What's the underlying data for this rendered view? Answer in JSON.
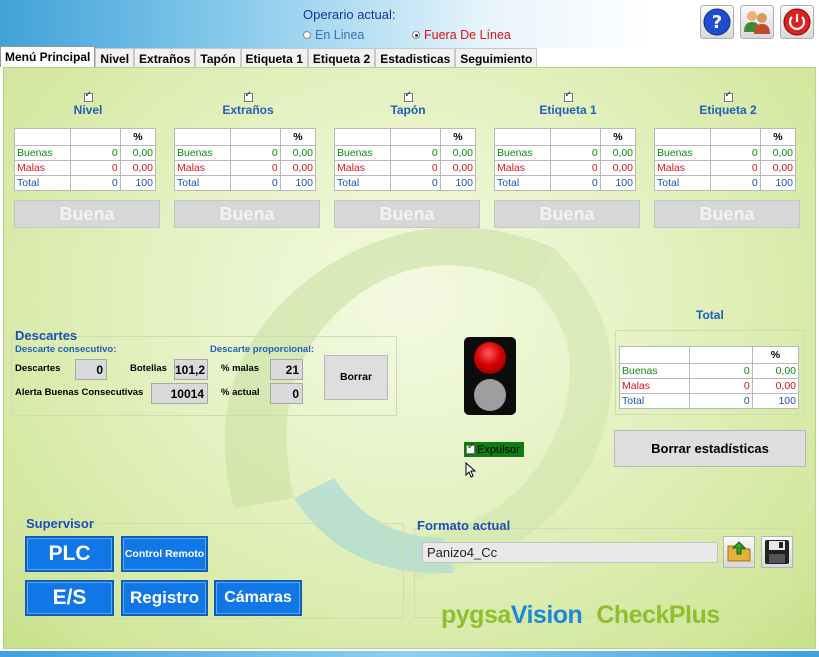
{
  "header": {
    "operator_label": "Operario actual:",
    "radio_online": "En Linea",
    "radio_offline": "Fuera De Línea",
    "selected_mode": "offline"
  },
  "tabs": [
    "Menú Principal",
    "Nivel",
    "Extraños",
    "Tapón",
    "Etiqueta 1",
    "Etiqueta 2",
    "Estadisticas",
    "Seguimiento"
  ],
  "stat_table_labels": {
    "pct": "%",
    "good": "Buenas",
    "bad": "Malas",
    "total": "Total"
  },
  "stations": [
    {
      "name": "Nivel",
      "good": "0",
      "good_pct": "0,00",
      "bad": "0",
      "bad_pct": "0,00",
      "total": "0",
      "total_pct": "100",
      "status": "Buena"
    },
    {
      "name": "Extraños",
      "good": "0",
      "good_pct": "0,00",
      "bad": "0",
      "bad_pct": "0,00",
      "total": "0",
      "total_pct": "100",
      "status": "Buena"
    },
    {
      "name": "Tapón",
      "good": "0",
      "good_pct": "0,00",
      "bad": "0",
      "bad_pct": "0,00",
      "total": "0",
      "total_pct": "100",
      "status": "Buena"
    },
    {
      "name": "Etiqueta 1",
      "good": "0",
      "good_pct": "0,00",
      "bad": "0",
      "bad_pct": "0,00",
      "total": "0",
      "total_pct": "100",
      "status": "Buena"
    },
    {
      "name": "Etiqueta 2",
      "good": "0",
      "good_pct": "0,00",
      "bad": "0",
      "bad_pct": "0,00",
      "total": "0",
      "total_pct": "100",
      "status": "Buena"
    }
  ],
  "descartes": {
    "title": "Descartes",
    "consecutive_label": "Descarte consecutivo:",
    "proportional_label": "Descarte proporcional:",
    "descartes_label": "Descartes",
    "descartes_value": "0",
    "botellas_label": "Botellas",
    "botellas_value": "101,2",
    "malas_label": "% malas",
    "malas_value": "21",
    "alerta_label": "Alerta Buenas Consecutivas",
    "alerta_value": "10014",
    "actual_label": "% actual",
    "actual_value": "0",
    "borrar_label": "Borrar"
  },
  "expulsor": {
    "label": "Expulsor",
    "checked": true
  },
  "total": {
    "title": "Total",
    "good": "0",
    "good_pct": "0,00",
    "bad": "0",
    "bad_pct": "0,00",
    "total": "0",
    "total_pct": "100",
    "clear_label": "Borrar estadísticas"
  },
  "supervisor": {
    "title": "Supervisor",
    "plc": "PLC",
    "control_remoto": "Control Remoto",
    "es": "E/S",
    "registro": "Registro",
    "camaras": "Cámaras"
  },
  "formato": {
    "title": "Formato actual",
    "value": "Panizo4_Cc"
  },
  "brand": {
    "part1": "pygsa",
    "part2": "Vision",
    "part3": "CheckPlus"
  },
  "colors": {
    "good": "#118a11",
    "bad": "#e0101a",
    "total": "#1d4fb8",
    "accent": "#1277e6",
    "panel": "#d2e79c"
  }
}
